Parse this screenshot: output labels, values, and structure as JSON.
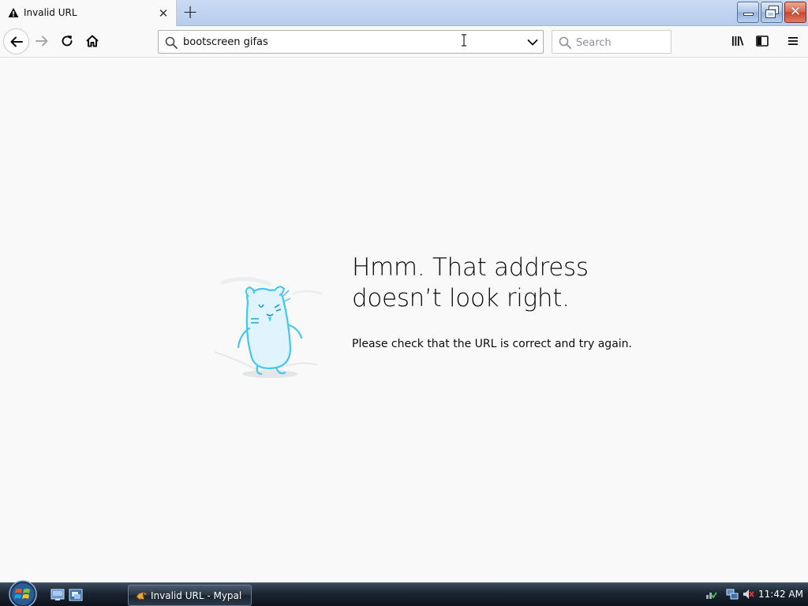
{
  "browser": {
    "tab": {
      "title": "Invalid URL",
      "close_glyph": "✕"
    },
    "new_tab_glyph": "+",
    "url": {
      "value": "bootscreen gifas"
    },
    "search": {
      "placeholder": "Search"
    }
  },
  "error_page": {
    "title_line1": "Hmm. That address",
    "title_line2": "doesn’t look right.",
    "description": "Please check that the URL is correct and try again."
  },
  "taskbar": {
    "task_label": "Invalid URL - Mypal",
    "clock": "11:42 AM"
  },
  "colors": {
    "tab_strip": "#c0d4ef",
    "page_bg": "#f9f9fa",
    "illustration_accent": "#45c5ef",
    "taskbar": "#1a2430"
  }
}
